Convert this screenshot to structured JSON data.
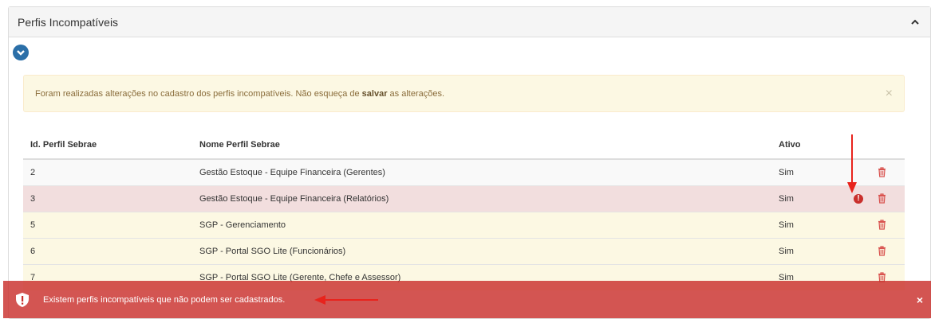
{
  "panel": {
    "title": "Perfis Incompatíveis",
    "collapse_icon": "chevron-up-icon",
    "expand_icon": "chevron-down-circle-icon"
  },
  "alert": {
    "text_before": "Foram realizadas alterações no cadastro dos perfis incompatíveis. Não esqueça de ",
    "text_bold": "salvar",
    "text_after": " as alterações.",
    "close": "×"
  },
  "table": {
    "headers": [
      "Id. Perfil Sebrae",
      "Nome Perfil Sebrae",
      "Ativo",
      ""
    ],
    "rows": [
      {
        "id": "2",
        "nome": "Gestão Estoque - Equipe Financeira (Gerentes)",
        "ativo": "Sim",
        "status": "white"
      },
      {
        "id": "3",
        "nome": "Gestão Estoque - Equipe Financeira (Relatórios)",
        "ativo": "Sim",
        "status": "danger"
      },
      {
        "id": "5",
        "nome": "SGP - Gerenciamento",
        "ativo": "Sim",
        "status": "warning"
      },
      {
        "id": "6",
        "nome": "SGP - Portal SGO Lite (Funcionários)",
        "ativo": "Sim",
        "status": "warning"
      },
      {
        "id": "7",
        "nome": "SGP - Portal SGO Lite (Gerente, Chefe e Assessor)",
        "ativo": "Sim",
        "status": "warning"
      }
    ],
    "warning_icon_label": "!"
  },
  "toast": {
    "message": "Existem perfis incompatíveis que não podem ser cadastrados.",
    "close": "×",
    "icon": "shield-alert-icon"
  },
  "colors": {
    "danger_row": "#f2dede",
    "warning_row": "#fcf8e3",
    "toast_bg": "#c9302c",
    "primary": "#2b6fa8",
    "trash": "#d9534f",
    "annotation_arrow": "#e8231c"
  }
}
